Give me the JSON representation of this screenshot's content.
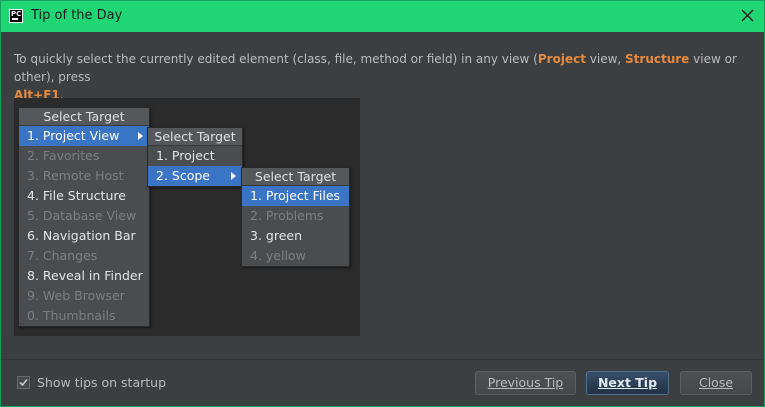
{
  "window": {
    "title": "Tip of the Day",
    "app_icon_text": "PC"
  },
  "tip": {
    "text_1": "To quickly select the currently edited element (class, file, method or field) in any view (",
    "highlight_1": "Project",
    "text_2": " view, ",
    "highlight_2": "Structure",
    "text_3": " view or other), press",
    "shortcut": "Alt+F1",
    "text_4": "."
  },
  "illustration": {
    "menu1": {
      "title": "Select Target",
      "items": [
        {
          "label": "1. Project View",
          "state": "selected",
          "submenu": true
        },
        {
          "label": "2. Favorites",
          "state": "disabled"
        },
        {
          "label": "3. Remote Host",
          "state": "disabled"
        },
        {
          "label": "4. File Structure",
          "state": "normal"
        },
        {
          "label": "5. Database View",
          "state": "disabled"
        },
        {
          "label": "6. Navigation Bar",
          "state": "normal"
        },
        {
          "label": "7. Changes",
          "state": "disabled"
        },
        {
          "label": "8. Reveal in Finder",
          "state": "normal"
        },
        {
          "label": "9. Web Browser",
          "state": "disabled"
        },
        {
          "label": "0. Thumbnails",
          "state": "disabled"
        }
      ]
    },
    "menu2": {
      "title": "Select Target",
      "items": [
        {
          "label": "1. Project",
          "state": "normal"
        },
        {
          "label": "2. Scope",
          "state": "selected",
          "submenu": true
        }
      ]
    },
    "menu3": {
      "title": "Select Target",
      "items": [
        {
          "label": "1. Project Files",
          "state": "selected"
        },
        {
          "label": "2. Problems",
          "state": "disabled"
        },
        {
          "label": "3. green",
          "state": "normal"
        },
        {
          "label": "4. yellow",
          "state": "disabled"
        }
      ]
    }
  },
  "footer": {
    "show_tips_label": "Show tips on startup",
    "show_tips_checked": true,
    "previous_label": "Previous Tip",
    "next_label": "Next Tip",
    "close_label": "Close"
  },
  "colors": {
    "titlebar": "#1fd574",
    "background": "#3c3f41",
    "highlight": "#e6893c",
    "selection": "#3a74c5"
  }
}
